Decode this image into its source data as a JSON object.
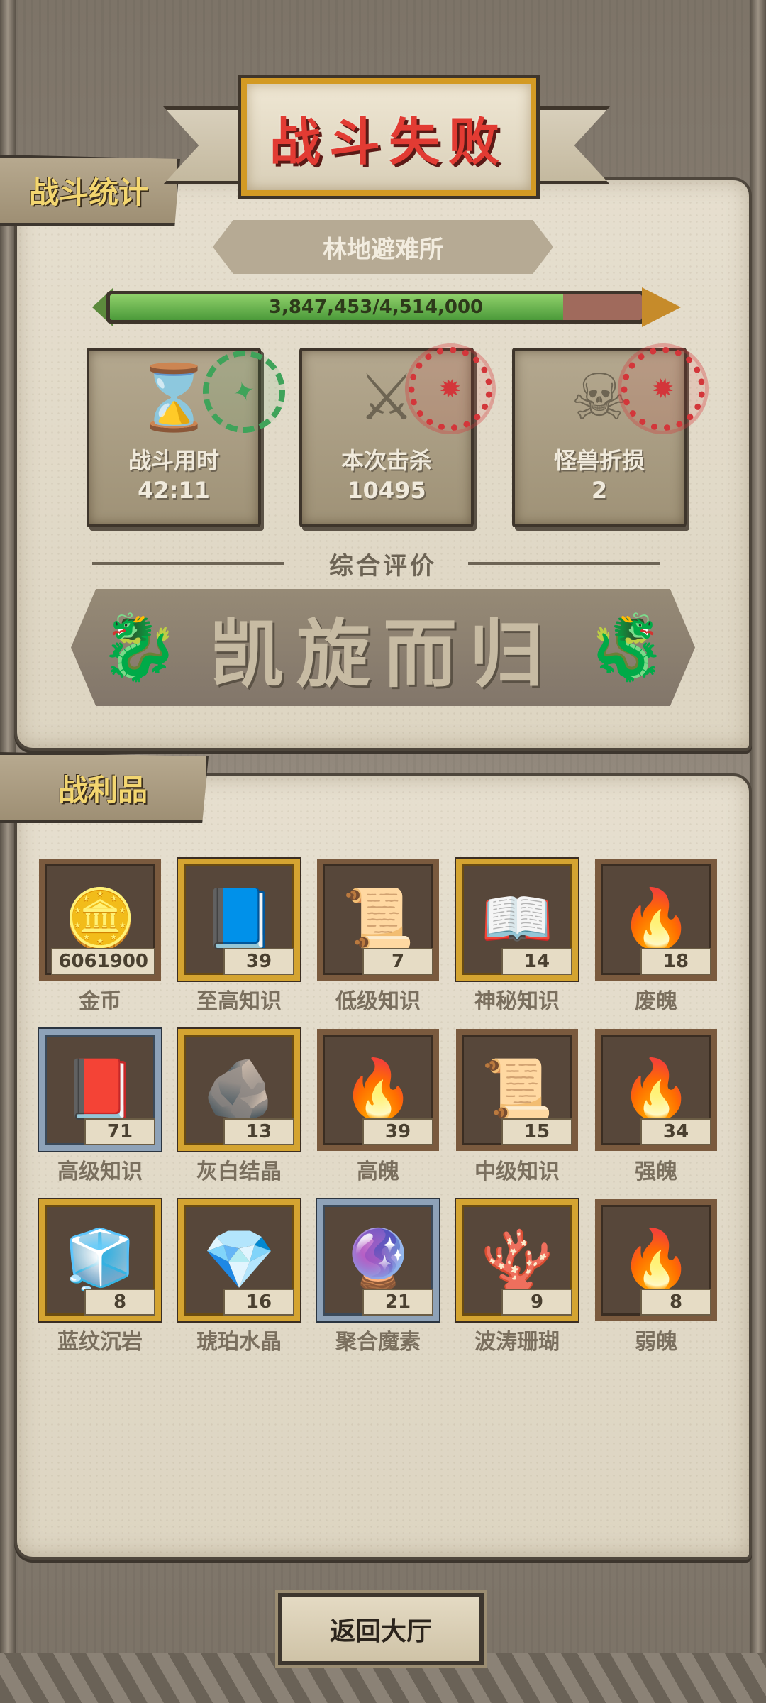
{
  "header": {
    "title": "战斗失败",
    "stats_tab": "战斗统计",
    "loot_tab": "战利品"
  },
  "location": "林地避难所",
  "progress": {
    "text": "3,847,453/4,514,000",
    "current": 3847453,
    "max": 4514000
  },
  "stats": [
    {
      "label": "战斗用时",
      "value": "42:11",
      "icon": "hourglass-icon",
      "stamp_color": "green"
    },
    {
      "label": "本次击杀",
      "value": "10495",
      "icon": "crossed-swords-icon",
      "stamp_color": "red"
    },
    {
      "label": "怪兽折损",
      "value": "2",
      "icon": "skull-icon",
      "stamp_color": "red"
    }
  ],
  "rating": {
    "label": "综合评价",
    "grade": "凯旋而归"
  },
  "loot": [
    {
      "name": "金币",
      "count": "6061900",
      "icon": "gold-coin-icon",
      "frame": "bronze"
    },
    {
      "name": "至高知识",
      "count": "39",
      "icon": "treasure-book-icon",
      "frame": "gold"
    },
    {
      "name": "低级知识",
      "count": "7",
      "icon": "scroll-icon",
      "frame": "bronze"
    },
    {
      "name": "神秘知识",
      "count": "14",
      "icon": "stone-tablet-icon",
      "frame": "gold"
    },
    {
      "name": "废魄",
      "count": "18",
      "icon": "flame-icon",
      "frame": "bronze"
    },
    {
      "name": "高级知识",
      "count": "71",
      "icon": "tied-book-icon",
      "frame": "blue"
    },
    {
      "name": "灰白结晶",
      "count": "13",
      "icon": "crystal-icon",
      "frame": "gold"
    },
    {
      "name": "高魄",
      "count": "39",
      "icon": "flame-icon",
      "frame": "bronze"
    },
    {
      "name": "中级知识",
      "count": "15",
      "icon": "scroll-icon",
      "frame": "bronze"
    },
    {
      "name": "强魄",
      "count": "34",
      "icon": "flame-icon",
      "frame": "bronze"
    },
    {
      "name": "蓝纹沉岩",
      "count": "8",
      "icon": "blue-rock-icon",
      "frame": "gold"
    },
    {
      "name": "琥珀水晶",
      "count": "16",
      "icon": "amber-crystal-icon",
      "frame": "gold"
    },
    {
      "name": "聚合魔素",
      "count": "21",
      "icon": "mana-orb-icon",
      "frame": "blue"
    },
    {
      "name": "波涛珊瑚",
      "count": "9",
      "icon": "coral-icon",
      "frame": "gold"
    },
    {
      "name": "弱魄",
      "count": "8",
      "icon": "flame-icon",
      "frame": "bronze"
    }
  ],
  "back_button": "返回大厅"
}
